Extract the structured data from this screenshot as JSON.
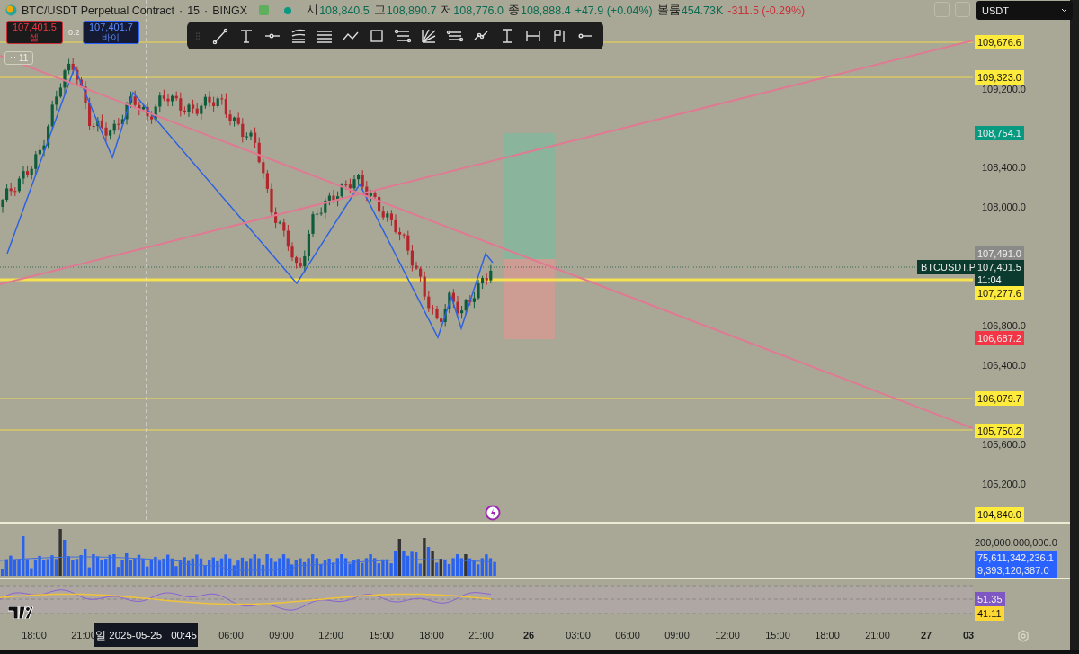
{
  "header": {
    "symbol": "BTC/USDT Perpetual Contract",
    "separators": [
      "·",
      "·"
    ],
    "interval": "15",
    "exchange": "BINGX",
    "ohlc": [
      {
        "label": "시",
        "value": "108,840.5"
      },
      {
        "label": "고",
        "value": "108,890.7"
      },
      {
        "label": "저",
        "value": "108,776.0"
      },
      {
        "label": "종",
        "value": "108,888.4"
      }
    ],
    "change": "+47.9 (+0.04%)",
    "volume_label": "볼륨",
    "volume_value": "454.73K",
    "volume_change": "-311.5 (-0.29%)"
  },
  "trade": {
    "sell_price": "107,401.5",
    "sell_label": "셀",
    "spread": "0.2",
    "buy_price": "107,401.7",
    "buy_label": "바이"
  },
  "collapse_button": {
    "label": "11"
  },
  "currency_select": {
    "value": "USDT"
  },
  "price_axis": {
    "ticks": [
      "109,200.0",
      "108,400.0",
      "108,000.0",
      "106,800.0",
      "106,400.0",
      "105,600.0",
      "105,200.0"
    ],
    "markers": [
      {
        "text": "109,676.6",
        "color": "#ffeb3b"
      },
      {
        "text": "109,323.0",
        "color": "#ffeb3b"
      },
      {
        "text": "108,754.1",
        "color": "#089981"
      },
      {
        "text": "107,491.0",
        "color": "#8a8a88"
      },
      {
        "text": "107,401.5",
        "sub": "11:04",
        "color": "#0b3b2e"
      },
      {
        "text": "107,277.6",
        "color": "#ffeb3b"
      },
      {
        "text": "106,687.2",
        "color": "#f23645"
      },
      {
        "text": "106,079.7",
        "color": "#ffeb3b"
      },
      {
        "text": "105,750.2",
        "color": "#ffeb3b"
      },
      {
        "text": "104,840.0",
        "color": "#ffeb3b"
      }
    ]
  },
  "symbol_tag": "BTCUSDT.P",
  "volume_axis": {
    "tick": "200,000,000,000.0",
    "readings": [
      "75,611,342,236.1",
      "9,393,120,387.0"
    ]
  },
  "rsi_axis": {
    "readings": [
      {
        "text": "51.35",
        "color": "#7e57c2"
      },
      {
        "text": "41.11",
        "color": "#fdd835"
      }
    ]
  },
  "time_axis": {
    "labels": [
      {
        "text": "18:00",
        "kind": "time"
      },
      {
        "text": "21:00",
        "kind": "time"
      },
      {
        "text": "06:00",
        "kind": "time"
      },
      {
        "text": "09:00",
        "kind": "time"
      },
      {
        "text": "12:00",
        "kind": "time"
      },
      {
        "text": "15:00",
        "kind": "time"
      },
      {
        "text": "18:00",
        "kind": "time"
      },
      {
        "text": "21:00",
        "kind": "time"
      },
      {
        "text": "26",
        "kind": "day"
      },
      {
        "text": "03:00",
        "kind": "time"
      },
      {
        "text": "06:00",
        "kind": "time"
      },
      {
        "text": "09:00",
        "kind": "time"
      },
      {
        "text": "12:00",
        "kind": "time"
      },
      {
        "text": "15:00",
        "kind": "time"
      },
      {
        "text": "18:00",
        "kind": "time"
      },
      {
        "text": "21:00",
        "kind": "time"
      },
      {
        "text": "27",
        "kind": "day"
      },
      {
        "text": "03",
        "kind": "day"
      }
    ],
    "crosshair": {
      "date": "일 2025-05-25",
      "time": "00:45"
    }
  }
}
